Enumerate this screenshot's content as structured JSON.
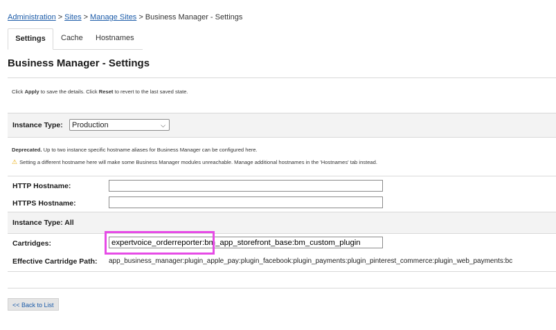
{
  "breadcrumb": {
    "administration": "Administration",
    "sites": "Sites",
    "manage_sites": "Manage Sites",
    "current": "Business Manager - Settings",
    "separator": ">"
  },
  "tabs": [
    {
      "label": "Settings",
      "active": true
    },
    {
      "label": "Cache",
      "active": false
    },
    {
      "label": "Hostnames",
      "active": false
    }
  ],
  "page_title": "Business Manager - Settings",
  "info": {
    "pre": "Click ",
    "apply": "Apply",
    "mid": " to save the details. Click ",
    "reset": "Reset",
    "post": " to revert to the last saved state."
  },
  "instance_type": {
    "label": "Instance Type:",
    "selected": "Production"
  },
  "deprecated": {
    "bold": "Deprecated.",
    "text": " Up to two instance specific hostname aliases for Business Manager can be configured here.",
    "warning": "Setting a different hostname here will make some Business Manager modules unreachable. Manage additional hostnames in the 'Hostnames' tab instead."
  },
  "hostnames": {
    "http_label": "HTTP Hostname:",
    "http_value": "",
    "https_label": "HTTPS Hostname:",
    "https_value": ""
  },
  "instance_all": {
    "label": "Instance Type: All"
  },
  "cartridges": {
    "label": "Cartridges:",
    "value": "expertvoice_orderreporter:bm_app_storefront_base:bm_custom_plugin"
  },
  "effective_path": {
    "label": "Effective Cartridge Path:",
    "value": "app_business_manager:plugin_apple_pay:plugin_facebook:plugin_payments:plugin_pinterest_commerce:plugin_web_payments:bc"
  },
  "back_button": "<< Back to List",
  "colors": {
    "link": "#1a5aa8",
    "highlight": "#e64be6",
    "warning": "#e8a800"
  }
}
